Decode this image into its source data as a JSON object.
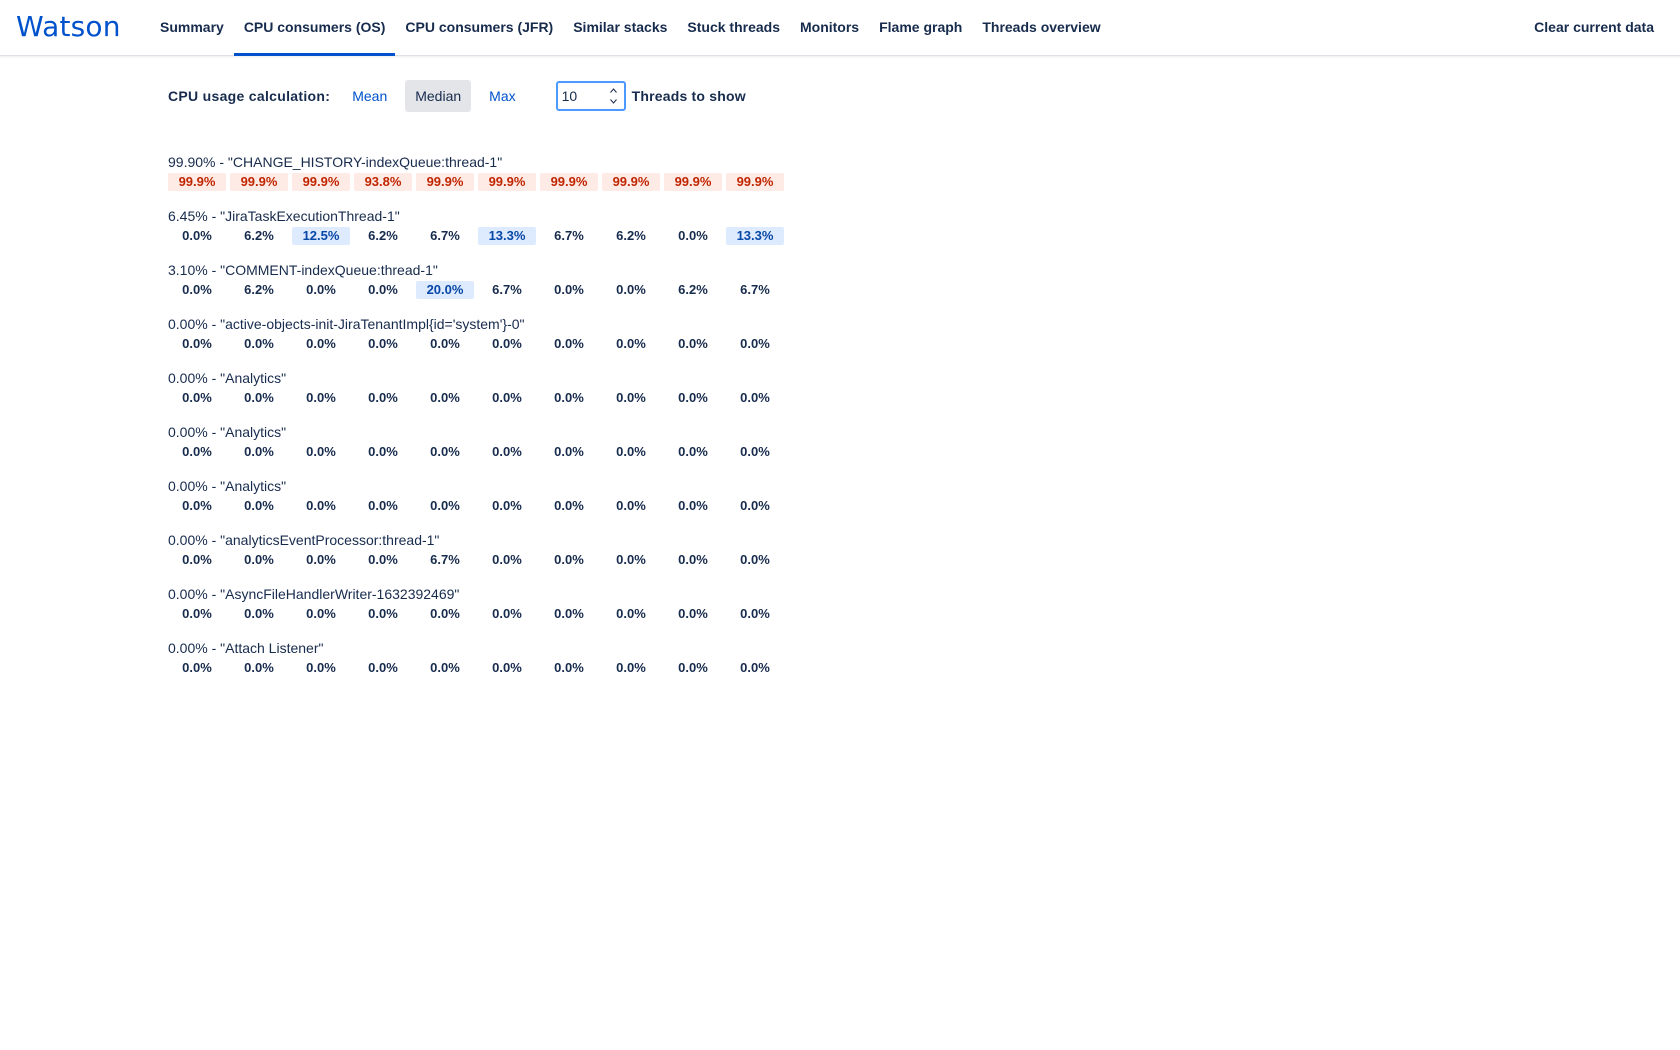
{
  "app": {
    "logo": "Watson"
  },
  "nav": {
    "items": [
      {
        "label": "Summary",
        "active": false
      },
      {
        "label": "CPU consumers (OS)",
        "active": true
      },
      {
        "label": "CPU consumers (JFR)",
        "active": false
      },
      {
        "label": "Similar stacks",
        "active": false
      },
      {
        "label": "Stuck threads",
        "active": false
      },
      {
        "label": "Monitors",
        "active": false
      },
      {
        "label": "Flame graph",
        "active": false
      },
      {
        "label": "Threads overview",
        "active": false
      }
    ],
    "clear_label": "Clear current data"
  },
  "controls": {
    "label": "CPU usage calculation:",
    "modes": [
      "Mean",
      "Median",
      "Max"
    ],
    "selected_mode": "Median",
    "threads_value": "10",
    "threads_label": "Threads to show"
  },
  "colors": {
    "accent": "#0052cc",
    "hot_bg": "#ffebe6",
    "hot_text": "#bf2600",
    "warm_bg": "#deebff",
    "warm_text": "#0747a6"
  },
  "threads": [
    {
      "title": "99.90% - \"CHANGE_HISTORY-indexQueue:thread-1\"",
      "values": [
        "99.9%",
        "99.9%",
        "99.9%",
        "93.8%",
        "99.9%",
        "99.9%",
        "99.9%",
        "99.9%",
        "99.9%",
        "99.9%"
      ]
    },
    {
      "title": "6.45% - \"JiraTaskExecutionThread-1\"",
      "values": [
        "0.0%",
        "6.2%",
        "12.5%",
        "6.2%",
        "6.7%",
        "13.3%",
        "6.7%",
        "6.2%",
        "0.0%",
        "13.3%"
      ]
    },
    {
      "title": "3.10% - \"COMMENT-indexQueue:thread-1\"",
      "values": [
        "0.0%",
        "6.2%",
        "0.0%",
        "0.0%",
        "20.0%",
        "6.7%",
        "0.0%",
        "0.0%",
        "6.2%",
        "6.7%"
      ]
    },
    {
      "title": "0.00% - \"active-objects-init-JiraTenantImpl{id='system'}-0\"",
      "values": [
        "0.0%",
        "0.0%",
        "0.0%",
        "0.0%",
        "0.0%",
        "0.0%",
        "0.0%",
        "0.0%",
        "0.0%",
        "0.0%"
      ]
    },
    {
      "title": "0.00% - \"Analytics\"",
      "values": [
        "0.0%",
        "0.0%",
        "0.0%",
        "0.0%",
        "0.0%",
        "0.0%",
        "0.0%",
        "0.0%",
        "0.0%",
        "0.0%"
      ]
    },
    {
      "title": "0.00% - \"Analytics\"",
      "values": [
        "0.0%",
        "0.0%",
        "0.0%",
        "0.0%",
        "0.0%",
        "0.0%",
        "0.0%",
        "0.0%",
        "0.0%",
        "0.0%"
      ]
    },
    {
      "title": "0.00% - \"Analytics\"",
      "values": [
        "0.0%",
        "0.0%",
        "0.0%",
        "0.0%",
        "0.0%",
        "0.0%",
        "0.0%",
        "0.0%",
        "0.0%",
        "0.0%"
      ]
    },
    {
      "title": "0.00% - \"analyticsEventProcessor:thread-1\"",
      "values": [
        "0.0%",
        "0.0%",
        "0.0%",
        "0.0%",
        "6.7%",
        "0.0%",
        "0.0%",
        "0.0%",
        "0.0%",
        "0.0%"
      ]
    },
    {
      "title": "0.00% - \"AsyncFileHandlerWriter-1632392469\"",
      "values": [
        "0.0%",
        "0.0%",
        "0.0%",
        "0.0%",
        "0.0%",
        "0.0%",
        "0.0%",
        "0.0%",
        "0.0%",
        "0.0%"
      ]
    },
    {
      "title": "0.00% - \"Attach Listener\"",
      "values": [
        "0.0%",
        "0.0%",
        "0.0%",
        "0.0%",
        "0.0%",
        "0.0%",
        "0.0%",
        "0.0%",
        "0.0%",
        "0.0%"
      ]
    }
  ]
}
